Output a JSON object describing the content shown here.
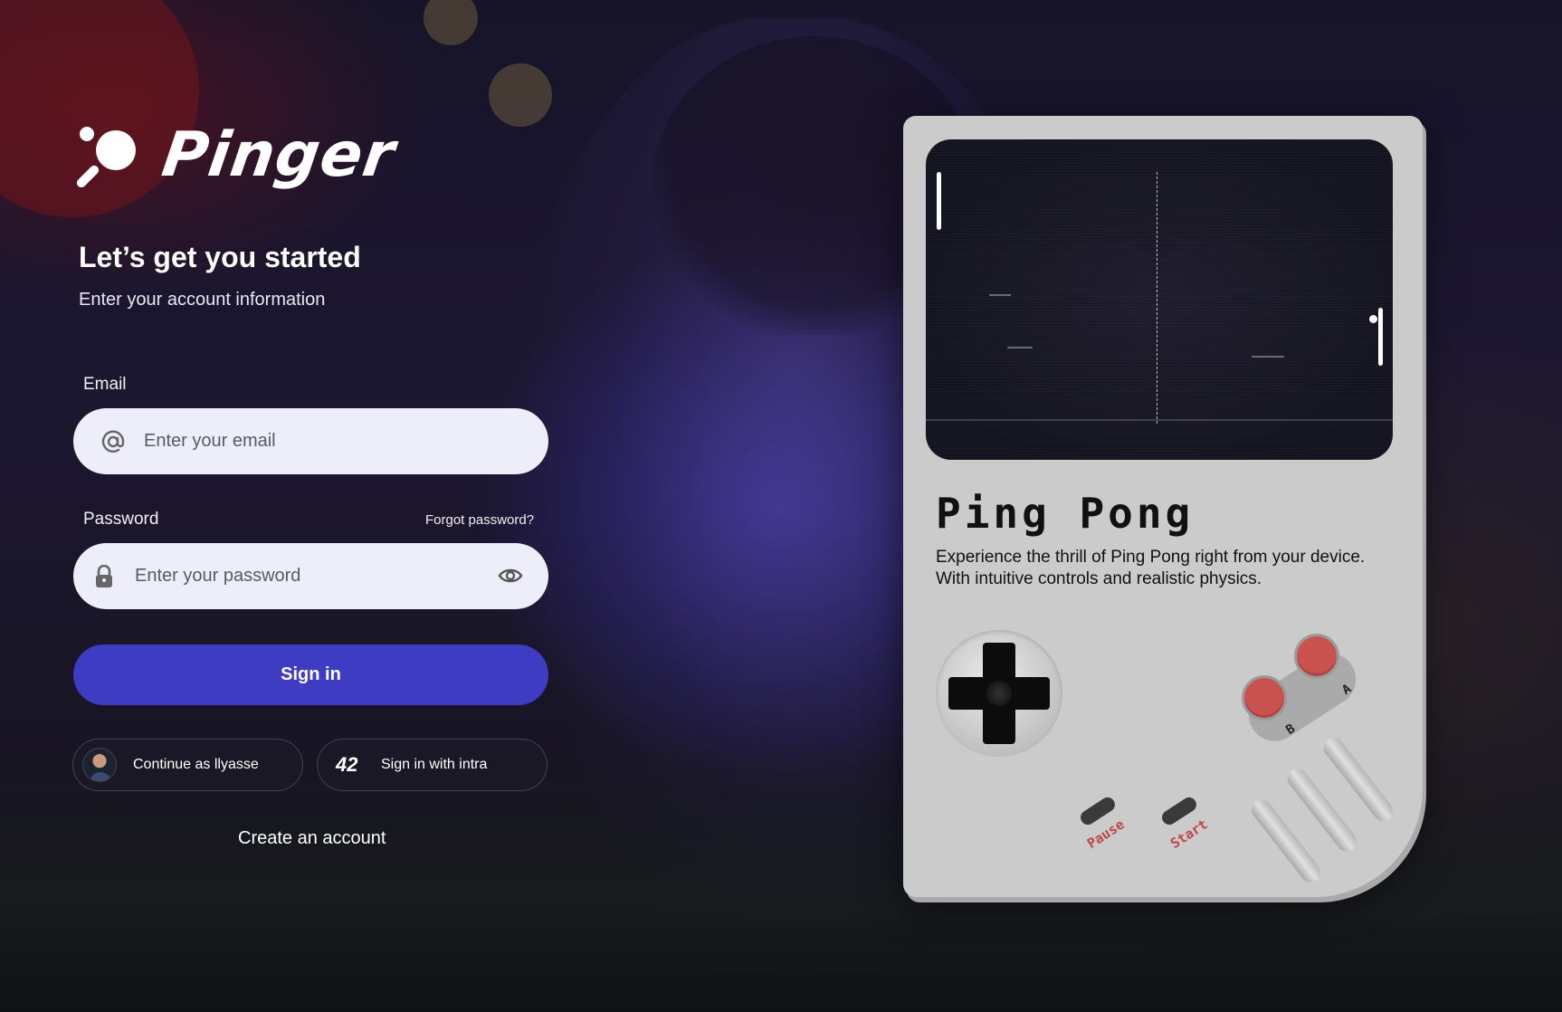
{
  "brand": {
    "name": "Pinger"
  },
  "auth": {
    "heading": "Let’s get you started",
    "subheading": "Enter your account information",
    "email": {
      "label": "Email",
      "placeholder": "Enter your email",
      "value": ""
    },
    "password": {
      "label": "Password",
      "placeholder": "Enter your password",
      "value": "",
      "forgot_label": "Forgot password?"
    },
    "signin_label": "Sign in",
    "continue_as_label": "Continue as llyasse",
    "intra_label": "Sign in with intra",
    "intra_logo_text": "42",
    "create_account_label": "Create an account"
  },
  "game": {
    "title": "Ping Pong",
    "description": [
      "Experience the thrill of Ping Pong right from your device.",
      "With intuitive controls and realistic physics."
    ],
    "buttons": {
      "a": "A",
      "b": "B",
      "pause": "Pause",
      "start": "Start"
    }
  },
  "colors": {
    "primary": "#3f3cc4",
    "input_bg": "#eeeefa",
    "console_body": "#cbcbcb",
    "action_button": "#c9524f",
    "screen_bg": "#1f1d2b"
  },
  "icons": {
    "email": "at-icon",
    "password": "lock-icon",
    "toggle_visibility": "eye-icon",
    "logo": "ping-pong-paddle-icon"
  }
}
